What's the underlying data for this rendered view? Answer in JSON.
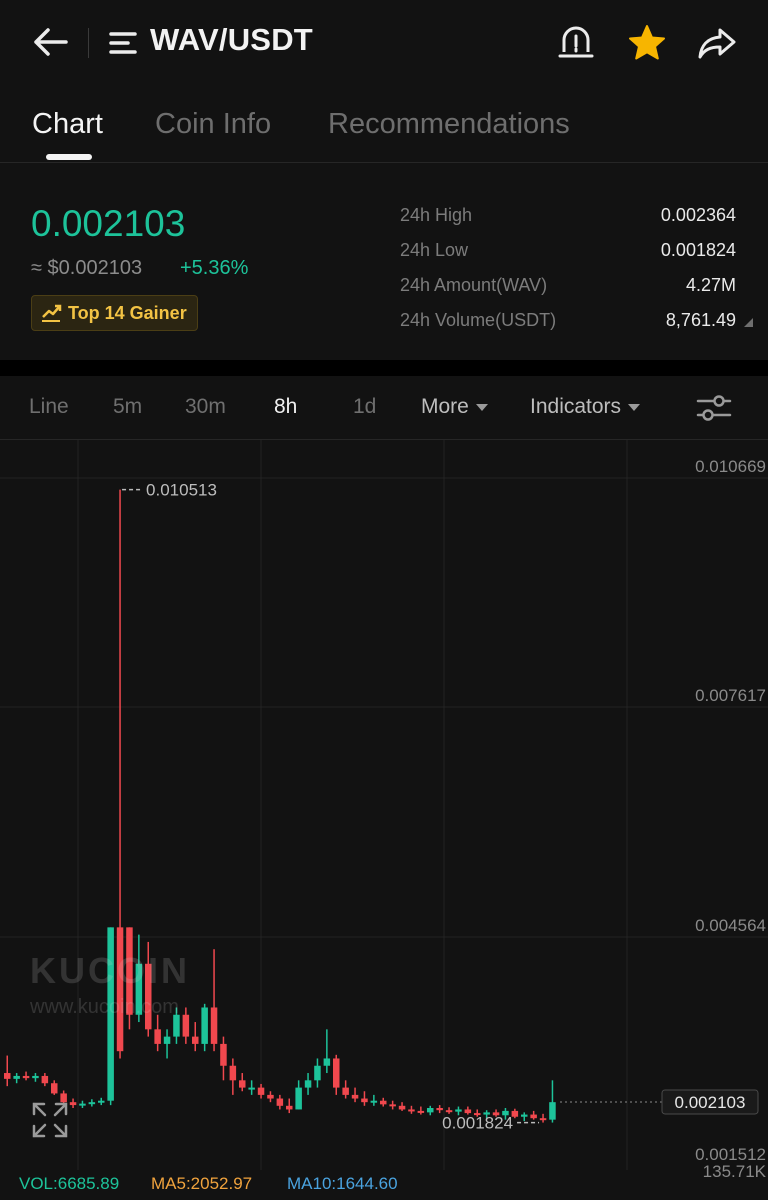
{
  "header": {
    "pair": "WAV/USDT",
    "icons": {
      "back": "back-arrow-icon",
      "menu": "menu-list-icon",
      "alert": "price-alert-icon",
      "favorite": "star-icon",
      "share": "share-icon"
    },
    "favorite_color": "#f7b500"
  },
  "tabs": [
    {
      "label": "Chart",
      "active": true
    },
    {
      "label": "Coin Info",
      "active": false
    },
    {
      "label": "Recommendations",
      "active": false
    }
  ],
  "ticker": {
    "price": "0.002103",
    "price_usd": "≈ $0.002103",
    "change": "+5.36%",
    "badge": "Top 14 Gainer",
    "badge_icon": "trend-up-icon",
    "stats": [
      {
        "label": "24h High",
        "value": "0.002364"
      },
      {
        "label": "24h Low",
        "value": "0.001824"
      },
      {
        "label": "24h Amount(WAV)",
        "value": "4.27M"
      },
      {
        "label": "24h Volume(USDT)",
        "value": "8,761.49"
      }
    ],
    "up_color": "#1dc39a",
    "down_color": "#f0484e"
  },
  "intervals": {
    "items": [
      "Line",
      "5m",
      "30m",
      "8h",
      "1d"
    ],
    "active": "8h",
    "more_label": "More",
    "indicators_label": "Indicators"
  },
  "chart_data": {
    "type": "candlestick",
    "y_axis_labels": [
      "0.010669",
      "0.007617",
      "0.004564",
      "0.001512"
    ],
    "high_marker": "0.010513",
    "low_marker": "0.001824",
    "last_price": "0.002103",
    "volume_axis_label": "135.71K",
    "watermark": {
      "logo": "KUCOIN",
      "url": "www.kucoin.com"
    },
    "candles": [
      {
        "o": 0.0025,
        "h": 0.00274,
        "l": 0.00232,
        "c": 0.00242
      },
      {
        "o": 0.00242,
        "h": 0.0025,
        "l": 0.00236,
        "c": 0.00246
      },
      {
        "o": 0.00246,
        "h": 0.00252,
        "l": 0.0024,
        "c": 0.00243
      },
      {
        "o": 0.00243,
        "h": 0.0025,
        "l": 0.00238,
        "c": 0.00246
      },
      {
        "o": 0.00246,
        "h": 0.0025,
        "l": 0.00232,
        "c": 0.00236
      },
      {
        "o": 0.00236,
        "h": 0.0024,
        "l": 0.0022,
        "c": 0.00222
      },
      {
        "o": 0.00222,
        "h": 0.00226,
        "l": 0.00205,
        "c": 0.0021
      },
      {
        "o": 0.0021,
        "h": 0.00215,
        "l": 0.00202,
        "c": 0.00206
      },
      {
        "o": 0.00206,
        "h": 0.00212,
        "l": 0.00202,
        "c": 0.00208
      },
      {
        "o": 0.00208,
        "h": 0.00214,
        "l": 0.00204,
        "c": 0.0021
      },
      {
        "o": 0.0021,
        "h": 0.00216,
        "l": 0.00206,
        "c": 0.00212
      },
      {
        "o": 0.00212,
        "h": 0.0045,
        "l": 0.00206,
        "c": 0.0045
      },
      {
        "o": 0.0045,
        "h": 0.01051,
        "l": 0.0027,
        "c": 0.0028
      },
      {
        "o": 0.0045,
        "h": 0.0045,
        "l": 0.0031,
        "c": 0.0033
      },
      {
        "o": 0.0033,
        "h": 0.0044,
        "l": 0.0032,
        "c": 0.004
      },
      {
        "o": 0.004,
        "h": 0.0043,
        "l": 0.003,
        "c": 0.0031
      },
      {
        "o": 0.0031,
        "h": 0.0033,
        "l": 0.0028,
        "c": 0.0029
      },
      {
        "o": 0.0029,
        "h": 0.0031,
        "l": 0.0027,
        "c": 0.003
      },
      {
        "o": 0.003,
        "h": 0.0034,
        "l": 0.0029,
        "c": 0.0033
      },
      {
        "o": 0.0033,
        "h": 0.0034,
        "l": 0.0029,
        "c": 0.003
      },
      {
        "o": 0.003,
        "h": 0.0032,
        "l": 0.0028,
        "c": 0.0029
      },
      {
        "o": 0.0029,
        "h": 0.00345,
        "l": 0.0028,
        "c": 0.0034
      },
      {
        "o": 0.0034,
        "h": 0.0042,
        "l": 0.0028,
        "c": 0.0029
      },
      {
        "o": 0.0029,
        "h": 0.003,
        "l": 0.0024,
        "c": 0.0026
      },
      {
        "o": 0.0026,
        "h": 0.0027,
        "l": 0.0022,
        "c": 0.0024
      },
      {
        "o": 0.0024,
        "h": 0.0025,
        "l": 0.00225,
        "c": 0.0023
      },
      {
        "o": 0.0023,
        "h": 0.0024,
        "l": 0.0022,
        "c": 0.0023
      },
      {
        "o": 0.0023,
        "h": 0.00235,
        "l": 0.00215,
        "c": 0.0022
      },
      {
        "o": 0.0022,
        "h": 0.00225,
        "l": 0.0021,
        "c": 0.00215
      },
      {
        "o": 0.00215,
        "h": 0.0022,
        "l": 0.002,
        "c": 0.00205
      },
      {
        "o": 0.00205,
        "h": 0.00215,
        "l": 0.00195,
        "c": 0.002
      },
      {
        "o": 0.002,
        "h": 0.0024,
        "l": 0.002,
        "c": 0.0023
      },
      {
        "o": 0.0023,
        "h": 0.0025,
        "l": 0.0022,
        "c": 0.0024
      },
      {
        "o": 0.0024,
        "h": 0.0027,
        "l": 0.0023,
        "c": 0.0026
      },
      {
        "o": 0.0026,
        "h": 0.0031,
        "l": 0.0025,
        "c": 0.0027
      },
      {
        "o": 0.0027,
        "h": 0.00275,
        "l": 0.0022,
        "c": 0.0023
      },
      {
        "o": 0.0023,
        "h": 0.0024,
        "l": 0.00215,
        "c": 0.0022
      },
      {
        "o": 0.0022,
        "h": 0.0023,
        "l": 0.0021,
        "c": 0.00215
      },
      {
        "o": 0.00215,
        "h": 0.00225,
        "l": 0.00205,
        "c": 0.0021
      },
      {
        "o": 0.0021,
        "h": 0.0022,
        "l": 0.00205,
        "c": 0.00212
      },
      {
        "o": 0.00212,
        "h": 0.00216,
        "l": 0.00204,
        "c": 0.00207
      },
      {
        "o": 0.00207,
        "h": 0.00212,
        "l": 0.002,
        "c": 0.00205
      },
      {
        "o": 0.00205,
        "h": 0.0021,
        "l": 0.00198,
        "c": 0.002
      },
      {
        "o": 0.002,
        "h": 0.00205,
        "l": 0.00194,
        "c": 0.00198
      },
      {
        "o": 0.00198,
        "h": 0.00204,
        "l": 0.00193,
        "c": 0.00196
      },
      {
        "o": 0.00196,
        "h": 0.00205,
        "l": 0.00192,
        "c": 0.00202
      },
      {
        "o": 0.00202,
        "h": 0.00206,
        "l": 0.00195,
        "c": 0.00199
      },
      {
        "o": 0.00199,
        "h": 0.00203,
        "l": 0.00194,
        "c": 0.00197
      },
      {
        "o": 0.00197,
        "h": 0.00204,
        "l": 0.00192,
        "c": 0.002
      },
      {
        "o": 0.002,
        "h": 0.00204,
        "l": 0.00193,
        "c": 0.00195
      },
      {
        "o": 0.00195,
        "h": 0.002,
        "l": 0.0019,
        "c": 0.00193
      },
      {
        "o": 0.00193,
        "h": 0.00199,
        "l": 0.00188,
        "c": 0.00196
      },
      {
        "o": 0.00196,
        "h": 0.002,
        "l": 0.0019,
        "c": 0.00192
      },
      {
        "o": 0.00192,
        "h": 0.00202,
        "l": 0.00186,
        "c": 0.00198
      },
      {
        "o": 0.00198,
        "h": 0.00201,
        "l": 0.00188,
        "c": 0.0019
      },
      {
        "o": 0.0019,
        "h": 0.00196,
        "l": 0.00184,
        "c": 0.00193
      },
      {
        "o": 0.00193,
        "h": 0.00198,
        "l": 0.00186,
        "c": 0.00188
      },
      {
        "o": 0.00188,
        "h": 0.00194,
        "l": 0.00182,
        "c": 0.00186
      },
      {
        "o": 0.00186,
        "h": 0.0024,
        "l": 0.00182,
        "c": 0.0021
      }
    ],
    "indicators": [
      {
        "label": "VOL:6685.89",
        "color": "#1dc39a"
      },
      {
        "label": "MA5:2052.97",
        "color": "#f0a33d"
      },
      {
        "label": "MA10:1644.60",
        "color": "#4aa3df"
      }
    ]
  }
}
